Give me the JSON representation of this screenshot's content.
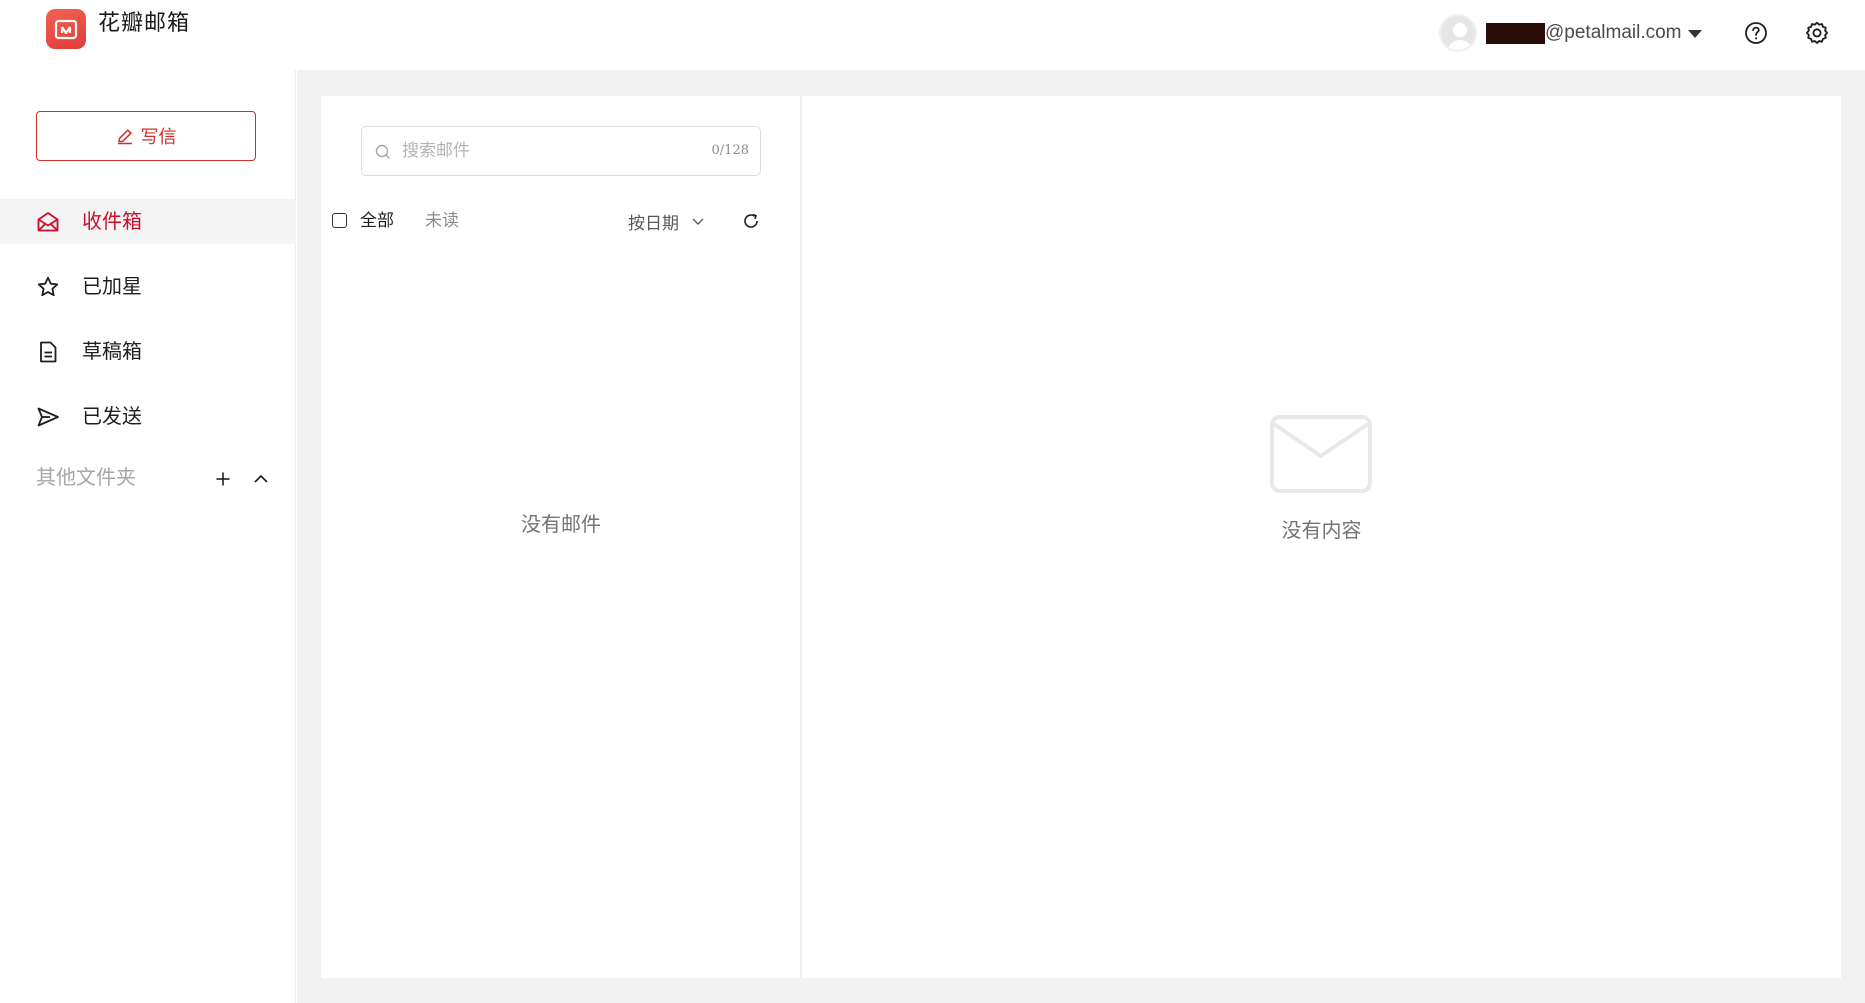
{
  "app": {
    "title": "花瓣邮箱",
    "brand_color": "#e13c3a"
  },
  "header": {
    "account_email_domain": "@petalmail.com",
    "icons": [
      "avatar-icon",
      "caret-down-icon",
      "help-icon",
      "gear-icon"
    ]
  },
  "sidebar": {
    "compose_label": "写信",
    "items": [
      {
        "label": "收件箱",
        "icon": "inbox-icon",
        "active": true
      },
      {
        "label": "已加星",
        "icon": "star-icon",
        "active": false
      },
      {
        "label": "草稿箱",
        "icon": "draft-icon",
        "active": false
      },
      {
        "label": "已发送",
        "icon": "send-icon",
        "active": false
      }
    ],
    "other_folders_label": "其他文件夹"
  },
  "mail_list": {
    "search_placeholder": "搜索邮件",
    "search_counter": "0/128",
    "filter_all": "全部",
    "filter_unread": "未读",
    "sort_label": "按日期",
    "empty_text": "没有邮件"
  },
  "detail": {
    "empty_text": "没有内容"
  },
  "colors": {
    "accent": "#c8102e",
    "background": "#f2f2f2"
  }
}
